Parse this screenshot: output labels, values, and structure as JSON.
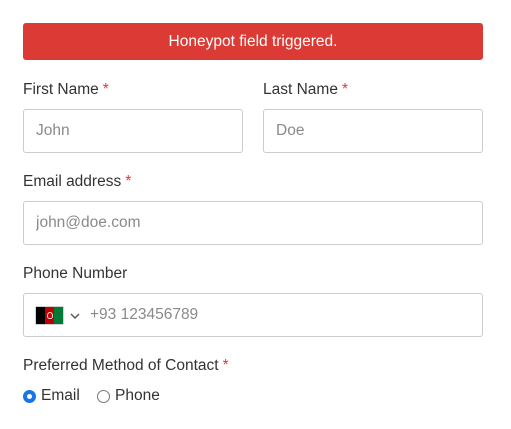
{
  "alert": {
    "message": "Honeypot field triggered."
  },
  "required_marker": "*",
  "fields": {
    "first_name": {
      "label": "First Name",
      "placeholder": "John",
      "value": ""
    },
    "last_name": {
      "label": "Last Name",
      "placeholder": "Doe",
      "value": ""
    },
    "email": {
      "label": "Email address",
      "placeholder": "john@doe.com",
      "value": ""
    },
    "phone": {
      "label": "Phone Number",
      "placeholder": "+93 123456789",
      "value": "",
      "country_icon": "afghanistan-flag-icon"
    }
  },
  "contact_method": {
    "label": "Preferred Method of Contact",
    "options": [
      {
        "label": "Email",
        "checked": true
      },
      {
        "label": "Phone",
        "checked": false
      }
    ]
  },
  "colors": {
    "alert_bg": "#dc3b35",
    "required": "#dc3b35",
    "radio_checked": "#1a73e8",
    "field_border": "#cccccc"
  }
}
